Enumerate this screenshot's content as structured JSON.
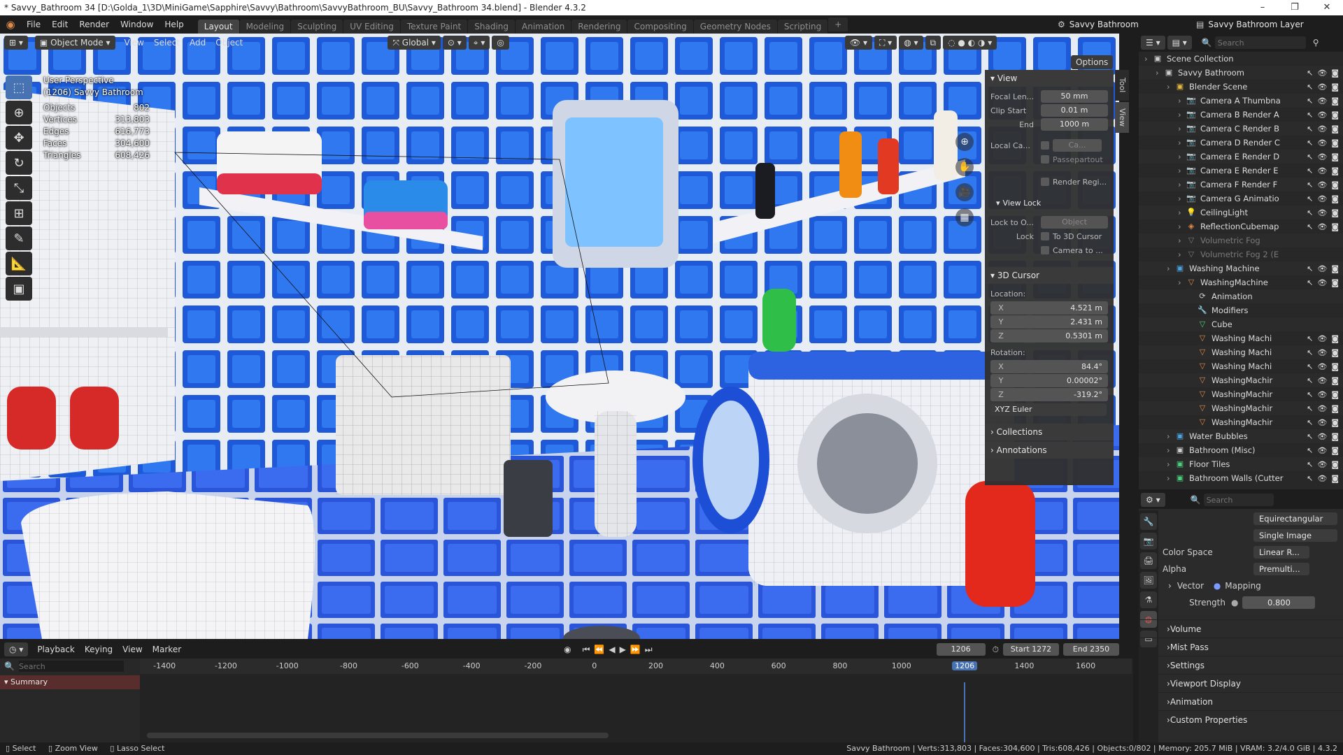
{
  "window": {
    "title": "* Savvy_Bathroom 34 [D:\\Golda_1\\3D\\MiniGame\\Sapphire\\Savvy\\Bathroom\\SavvyBathroom_BU\\Savvy_Bathroom 34.blend] - Blender 4.3.2",
    "minimize": "–",
    "maximize": "❐",
    "close": "✕"
  },
  "menus": [
    "File",
    "Edit",
    "Render",
    "Window",
    "Help"
  ],
  "workspaces": [
    "Layout",
    "Modeling",
    "Sculpting",
    "UV Editing",
    "Texture Paint",
    "Shading",
    "Animation",
    "Rendering",
    "Compositing",
    "Geometry Nodes",
    "Scripting"
  ],
  "active_workspace": "Layout",
  "add_workspace": "+",
  "scene": {
    "name": "Savvy Bathroom",
    "layer": "Savvy Bathroom Layer"
  },
  "viewport_header": {
    "mode": "Object Mode",
    "menus": [
      "View",
      "Select",
      "Add",
      "Object"
    ],
    "orientation": "Global",
    "options": "Options"
  },
  "viewport_info": {
    "perspective": "User Perspective",
    "object": "(1206) Savvy Bathroom"
  },
  "stats": [
    {
      "label": "Objects",
      "value": "802"
    },
    {
      "label": "Vertices",
      "value": "313,803"
    },
    {
      "label": "Edges",
      "value": "616,773"
    },
    {
      "label": "Faces",
      "value": "304,600"
    },
    {
      "label": "Triangles",
      "value": "608,426"
    }
  ],
  "npanel": {
    "view_title": "View",
    "focal_label": "Focal Len...",
    "focal_value": "50 mm",
    "clip_start_label": "Clip Start",
    "clip_start_value": "0.01 m",
    "clip_end_label": "End",
    "clip_end_value": "1000 m",
    "local_cam_label": "Local Ca...",
    "local_cam_value": "Ca...",
    "passepartout": "Passepartout",
    "render_region": "Render Regi...",
    "viewlock_title": "View Lock",
    "lock_obj_label": "Lock to O...",
    "lock_obj_value": "Object",
    "lock_label": "Lock",
    "lock_cursor": "To 3D Cursor",
    "lock_camera": "Camera to ...",
    "cursor_title": "3D Cursor",
    "location_label": "Location:",
    "loc": [
      {
        "a": "X",
        "v": "4.521 m"
      },
      {
        "a": "Y",
        "v": "2.431 m"
      },
      {
        "a": "Z",
        "v": "0.5301 m"
      }
    ],
    "rotation_label": "Rotation:",
    "rot": [
      {
        "a": "X",
        "v": "84.4°"
      },
      {
        "a": "Y",
        "v": "0.00002°"
      },
      {
        "a": "Z",
        "v": "-319.2°"
      }
    ],
    "rotation_mode": "XYZ Euler",
    "collections": "Collections",
    "annotations": "Annotations",
    "tabs": [
      "Tool",
      "View"
    ]
  },
  "timeline": {
    "menus": [
      "Playback",
      "Keying",
      "View",
      "Marker"
    ],
    "current_frame": "1206",
    "start_label": "Start",
    "start": "1272",
    "end_label": "End",
    "end": "2350",
    "search_placeholder": "Search",
    "summary": "Summary",
    "ticks": [
      "-1400",
      "-1200",
      "-1000",
      "-800",
      "-600",
      "-400",
      "-200",
      "0",
      "200",
      "400",
      "600",
      "800",
      "1000",
      "1206",
      "1400",
      "1600"
    ],
    "playhead": "1206"
  },
  "outliner": {
    "search_placeholder": "Search",
    "rows": [
      {
        "depth": 0,
        "label": "Scene Collection",
        "icon": "collection",
        "color": "#cfcfcf",
        "vis": false
      },
      {
        "depth": 1,
        "label": "Savvy Bathroom",
        "icon": "collection",
        "color": "#cfcfcf",
        "vis": true
      },
      {
        "depth": 2,
        "label": "Blender Scene",
        "icon": "collection",
        "color": "#e5b93c",
        "vis": true
      },
      {
        "depth": 3,
        "label": "Camera A Thumbna",
        "icon": "camera",
        "color": "#e08a4a",
        "vis": true
      },
      {
        "depth": 3,
        "label": "Camera B Render A",
        "icon": "camera",
        "color": "#e08a4a",
        "vis": true
      },
      {
        "depth": 3,
        "label": "Camera C Render B",
        "icon": "camera",
        "color": "#e08a4a",
        "vis": true
      },
      {
        "depth": 3,
        "label": "Camera D Render C",
        "icon": "camera",
        "color": "#e08a4a",
        "vis": true
      },
      {
        "depth": 3,
        "label": "Camera E Render D",
        "icon": "camera",
        "color": "#e08a4a",
        "vis": true
      },
      {
        "depth": 3,
        "label": "Camera E Render E",
        "icon": "camera",
        "color": "#e08a4a",
        "vis": true
      },
      {
        "depth": 3,
        "label": "Camera F Render F",
        "icon": "camera",
        "color": "#e08a4a",
        "vis": true
      },
      {
        "depth": 3,
        "label": "Camera G Animatio",
        "icon": "camera",
        "color": "#e08a4a",
        "vis": true
      },
      {
        "depth": 3,
        "label": "CeilingLight",
        "icon": "light",
        "color": "#e08a4a",
        "vis": true
      },
      {
        "depth": 3,
        "label": "ReflectionCubemap",
        "icon": "probe",
        "color": "#e08a4a",
        "vis": true
      },
      {
        "depth": 3,
        "label": "Volumetric Fog",
        "icon": "mesh",
        "color": "#7a7a7a",
        "vis": false
      },
      {
        "depth": 3,
        "label": "Volumetric Fog 2 (E",
        "icon": "mesh",
        "color": "#7a7a7a",
        "vis": false
      },
      {
        "depth": 2,
        "label": "Washing Machine",
        "icon": "collection",
        "color": "#4aa3e0",
        "vis": true
      },
      {
        "depth": 3,
        "label": "WashingMachine",
        "icon": "mesh",
        "color": "#e08a4a",
        "vis": true
      },
      {
        "depth": 4,
        "label": "Animation",
        "icon": "anim",
        "color": "#cfcfcf",
        "vis": false
      },
      {
        "depth": 4,
        "label": "Modifiers",
        "icon": "wrench",
        "color": "#6aa0e0",
        "vis": false
      },
      {
        "depth": 4,
        "label": "Cube",
        "icon": "mesh",
        "color": "#4ad07a",
        "vis": false
      },
      {
        "depth": 4,
        "label": "Washing Machi",
        "icon": "mesh",
        "color": "#e08a4a",
        "vis": true
      },
      {
        "depth": 4,
        "label": "Washing Machi",
        "icon": "mesh",
        "color": "#e08a4a",
        "vis": true
      },
      {
        "depth": 4,
        "label": "Washing Machi",
        "icon": "mesh",
        "color": "#e08a4a",
        "vis": true
      },
      {
        "depth": 4,
        "label": "WashingMachir",
        "icon": "mesh",
        "color": "#e08a4a",
        "vis": true
      },
      {
        "depth": 4,
        "label": "WashingMachir",
        "icon": "mesh",
        "color": "#e08a4a",
        "vis": true
      },
      {
        "depth": 4,
        "label": "WashingMachir",
        "icon": "mesh",
        "color": "#e08a4a",
        "vis": true
      },
      {
        "depth": 4,
        "label": "WashingMachir",
        "icon": "mesh",
        "color": "#e08a4a",
        "vis": true
      },
      {
        "depth": 2,
        "label": "Water Bubbles",
        "icon": "collection",
        "color": "#4aa3e0",
        "vis": true
      },
      {
        "depth": 2,
        "label": "Bathroom (Misc)",
        "icon": "collection",
        "color": "#cfcfcf",
        "vis": true
      },
      {
        "depth": 2,
        "label": "Floor Tiles",
        "icon": "collection",
        "color": "#4ad07a",
        "vis": true
      },
      {
        "depth": 2,
        "label": "Bathroom Walls (Cutter",
        "icon": "collection",
        "color": "#4ad07a",
        "vis": true
      }
    ]
  },
  "properties": {
    "search_placeholder": "Search",
    "projection": "Equirectangular",
    "source": "Single Image",
    "color_space_label": "Color Space",
    "color_space": "Linear R...",
    "alpha_label": "Alpha",
    "alpha": "Premulti...",
    "vector_label": "Vector",
    "vector_value": "Mapping",
    "strength_label": "Strength",
    "strength": "0.800",
    "sections": [
      "Volume",
      "Mist Pass",
      "Settings",
      "Viewport Display",
      "Animation",
      "Custom Properties"
    ]
  },
  "statusbar": {
    "select": "Select",
    "zoom": "Zoom View",
    "lasso": "Lasso Select",
    "info": "Savvy Bathroom | Verts:313,803 | Faces:304,600 | Tris:608,426 | Objects:0/802 | Memory: 205.7 MiB | VRAM: 3.2/4.0 GiB | 4.3.2"
  },
  "colors": {
    "accent": "#4772b3",
    "playhead": "#4772b3",
    "active_tab": "#444444"
  }
}
